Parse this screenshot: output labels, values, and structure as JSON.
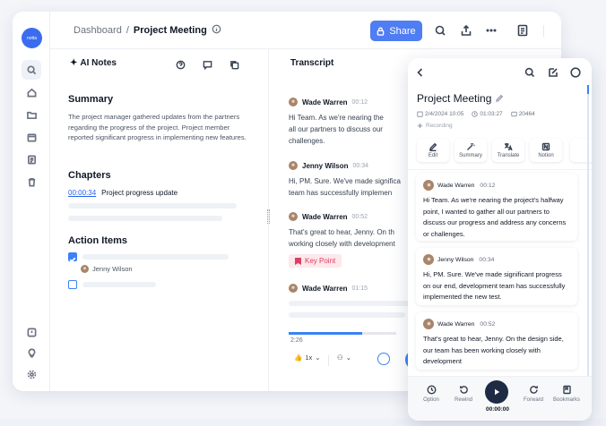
{
  "app": {
    "logo_text": "notta"
  },
  "breadcrumb": {
    "root": "Dashboard",
    "separator": "/",
    "current": "Project Meeting"
  },
  "toolbar": {
    "share_label": "Share"
  },
  "notes": {
    "title": "AI Notes",
    "summary_title": "Summary",
    "summary_text": "The project manager gathered updates from the partners regarding the progress of the project. Project member reported significant progress in implementing new features.",
    "chapters_title": "Chapters",
    "chapters": [
      {
        "time": "00:00:34",
        "label": "Project progress update"
      }
    ],
    "action_items_title": "Action Items",
    "action_items": [
      {
        "assignee": "Jenny Wilson",
        "checked": true
      },
      {
        "assignee": "",
        "checked": false
      }
    ]
  },
  "transcript": {
    "title": "Transcript",
    "entries": [
      {
        "speaker": "Wade Warren",
        "time": "00:12",
        "lines": [
          "Hi Team. As we're nearing the",
          "all our partners to discuss our",
          "challenges."
        ]
      },
      {
        "speaker": "Jenny Wilson",
        "time": "00:34",
        "lines": [
          "Hi, PM. Sure. We've made significa",
          "team has successfully implemen"
        ]
      },
      {
        "speaker": "Wade Warren",
        "time": "00:52",
        "lines": [
          "That's great to hear, Jenny. On th",
          "working closely with development"
        ]
      },
      {
        "speaker": "Wade Warren",
        "time": "01:15",
        "lines": []
      }
    ],
    "key_point_label": "Key Point",
    "playback": {
      "current_time": "2:26",
      "speed": "1x",
      "progress": 0.68
    }
  },
  "mobile": {
    "title": "Project Meeting",
    "date": "2/4/2024 10:05",
    "duration": "01:03:27",
    "id": "20464",
    "status": "Recording",
    "tools": [
      "Edit",
      "Summary",
      "Translate",
      "Notion"
    ],
    "entries": [
      {
        "speaker": "Wade Warren",
        "time": "00:12",
        "text": "Hi Team. As we're nearing the project's halfway point, I wanted to gather all our partners to discuss our progress and address any concerns or challenges."
      },
      {
        "speaker": "Jenny Wilson",
        "time": "00:34",
        "text": "Hi, PM. Sure. We've made significant progress on our end, development team has successfully implemented the new test."
      },
      {
        "speaker": "Wade Warren",
        "time": "00:52",
        "text": "That's great to hear, Jenny. On the design side, our team has been working closely with development"
      }
    ],
    "controls": {
      "option": "Option",
      "rewind": "Rewind",
      "forward": "Forward",
      "bookmarks": "Bookmarks",
      "time": "00:00:00"
    }
  }
}
